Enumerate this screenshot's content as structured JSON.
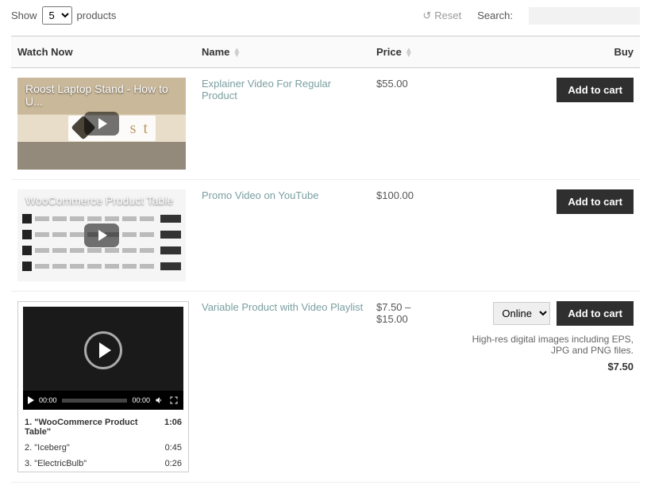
{
  "toolbar": {
    "show_label": "Show",
    "page_size": "5",
    "products_label": "products",
    "reset_label": "Reset",
    "search_label": "Search:"
  },
  "columns": {
    "watch": "Watch Now",
    "name": "Name",
    "price": "Price",
    "buy": "Buy"
  },
  "rows": [
    {
      "thumb_title": "Roost Laptop Stand - How to U...",
      "name": "Explainer Video For Regular Product",
      "price": "$55.00",
      "add_label": "Add to cart"
    },
    {
      "thumb_title": "WooCommerce Product Table",
      "name": "Promo Video on YouTube",
      "price": "$100.00",
      "add_label": "Add to cart"
    },
    {
      "name": "Variable Product with Video Playlist",
      "price": "$7.50 – $15.00",
      "variant": "Online",
      "add_label": "Add to cart",
      "desc": "High-res digital images including EPS, JPG and PNG files.",
      "sub_price": "$7.50",
      "player": {
        "time_start": "00:00",
        "time_end": "00:00"
      },
      "playlist": [
        {
          "label": "1. \"WooCommerce Product Table\"",
          "dur": "1:06"
        },
        {
          "label": "2. \"Iceberg\"",
          "dur": "0:45"
        },
        {
          "label": "3. \"ElectricBulb\"",
          "dur": "0:26"
        }
      ]
    }
  ]
}
